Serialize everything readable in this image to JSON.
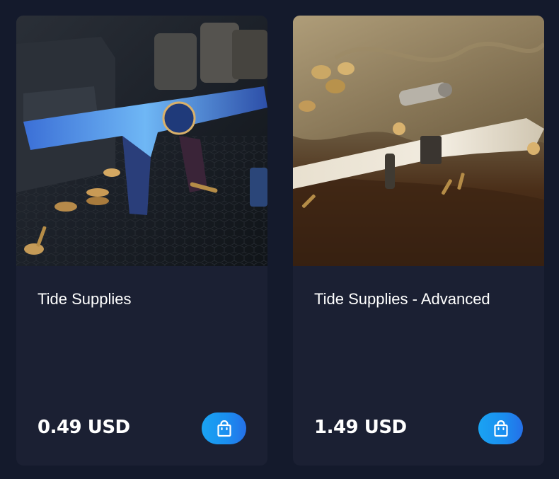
{
  "products": [
    {
      "title": "Tide Supplies",
      "price": "0.49 USD",
      "image_icon": "assault-rifle-skin-image"
    },
    {
      "title": "Tide Supplies - Advanced",
      "price": "1.49 USD",
      "image_icon": "sniper-rifle-skin-image"
    }
  ],
  "buy_button_icon": "shopping-bag-icon",
  "colors": {
    "page_background": "#141a2c",
    "card_background": "#1b2033",
    "accent_gradient_start": "#1aa3f2",
    "accent_gradient_end": "#2570e8",
    "text": "#ffffff"
  }
}
